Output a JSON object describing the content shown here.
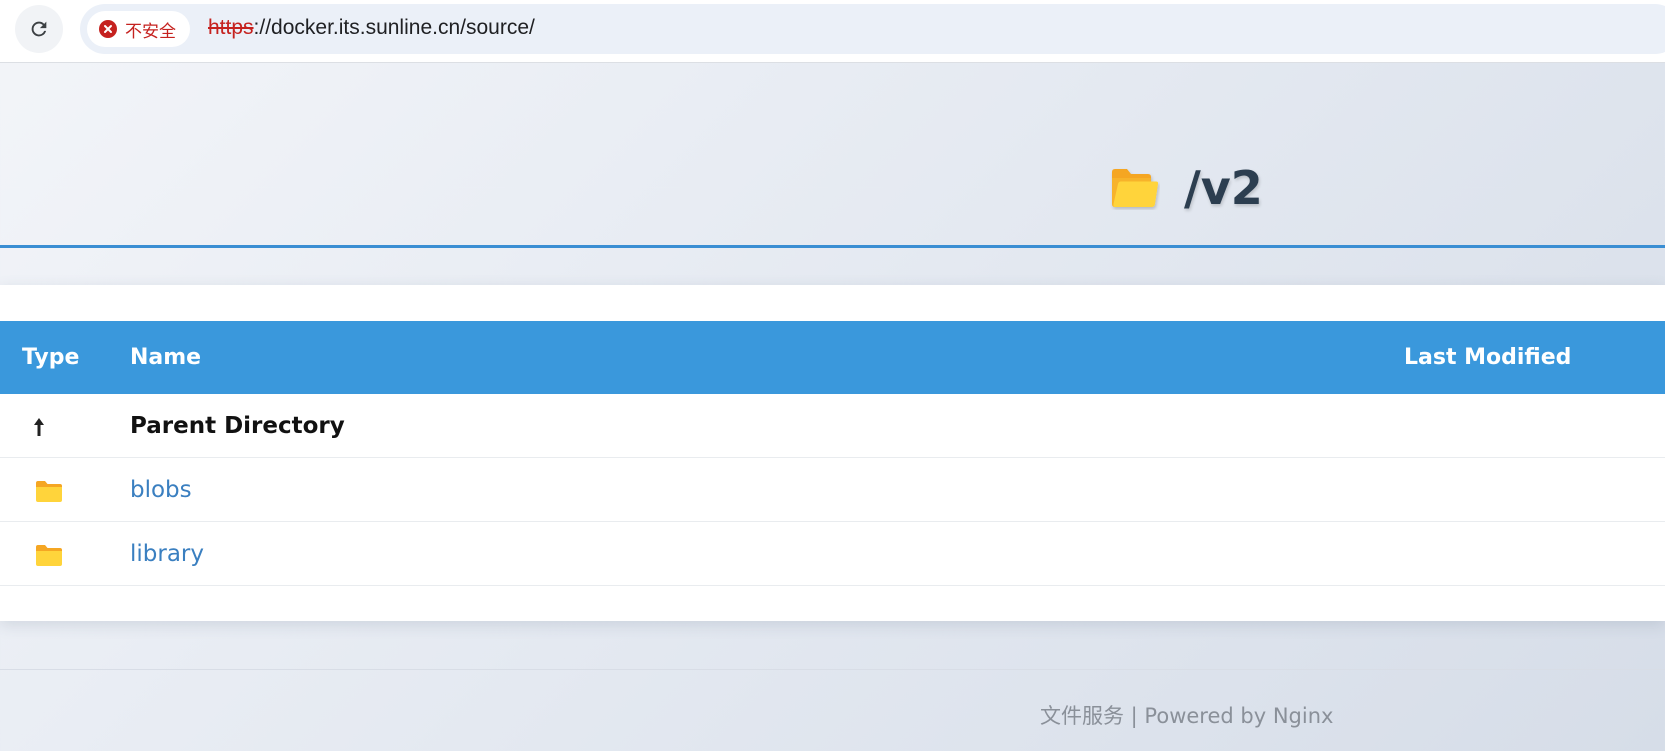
{
  "browser": {
    "security_label": "不安全",
    "url_scheme": "https",
    "url_rest": "://docker.its.sunline.cn/source/"
  },
  "header": {
    "title": "/v2",
    "icon": "folder-open-icon"
  },
  "table": {
    "columns": {
      "type": "Type",
      "name": "Name",
      "modified": "Last Modified"
    },
    "rows": [
      {
        "type_icon": "up-arrow-icon",
        "name": "Parent Directory",
        "modified": ""
      },
      {
        "type_icon": "folder-icon",
        "name": "blobs",
        "modified": ""
      },
      {
        "type_icon": "folder-icon",
        "name": "library",
        "modified": ""
      }
    ]
  },
  "footer": {
    "text": "文件服务 | Powered by Nginx"
  },
  "colors": {
    "accent": "#3a98dc",
    "link": "#3a7fc0",
    "folder": "#f5b82e",
    "title": "#2c3e50"
  }
}
